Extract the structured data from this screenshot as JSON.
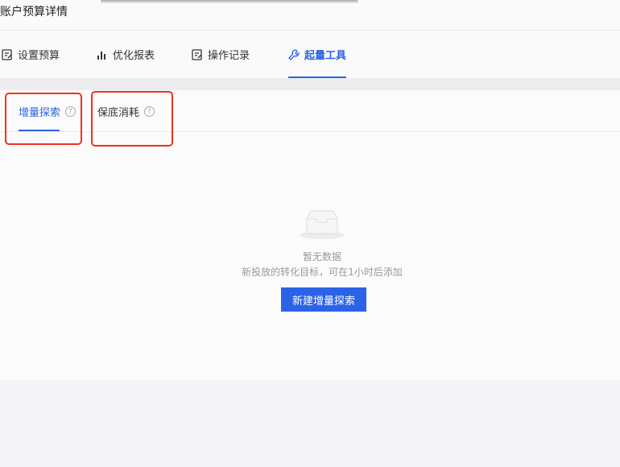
{
  "page_title": "账户预算详情",
  "tabs": [
    {
      "label": "设置预算",
      "icon": "edit-icon"
    },
    {
      "label": "优化报表",
      "icon": "bar-chart-icon"
    },
    {
      "label": "操作记录",
      "icon": "edit-icon"
    },
    {
      "label": "起量工具",
      "icon": "wrench-icon",
      "active": true
    }
  ],
  "subtabs": [
    {
      "label": "增量探索",
      "active": true
    },
    {
      "label": "保底消耗"
    }
  ],
  "help_glyph": "?",
  "empty": {
    "title": "暂无数据",
    "desc": "新投放的转化目标，可在1小时后添加",
    "button": "新建增量探索"
  },
  "colors": {
    "accent": "#2b63e8",
    "highlight": "#f0321e"
  }
}
